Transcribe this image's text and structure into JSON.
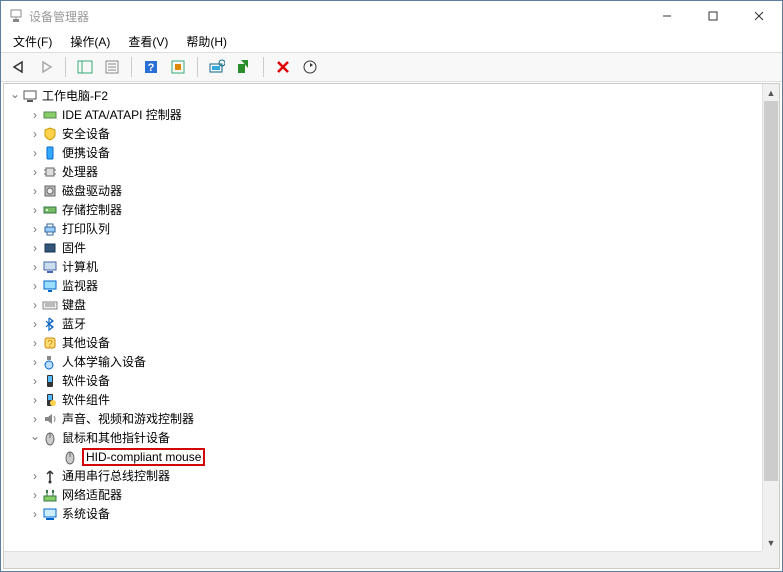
{
  "window": {
    "title": "设备管理器",
    "controls": {
      "min": "—",
      "max": "▢",
      "close": "✕"
    }
  },
  "menu": {
    "file": "文件(F)",
    "action": "操作(A)",
    "view": "查看(V)",
    "help": "帮助(H)"
  },
  "toolbar": {
    "back": "←",
    "forward": "→",
    "refresh": "⟳",
    "delete": "✕",
    "help_glyph": "?"
  },
  "tree": {
    "root": "工作电脑-F2",
    "expanded_root": true,
    "categories": [
      {
        "icon": "ide-icon",
        "label": "IDE ATA/ATAPI 控制器"
      },
      {
        "icon": "security-icon",
        "label": "安全设备"
      },
      {
        "icon": "portable-icon",
        "label": "便携设备"
      },
      {
        "icon": "cpu-icon",
        "label": "处理器"
      },
      {
        "icon": "disk-icon",
        "label": "磁盘驱动器"
      },
      {
        "icon": "storage-icon",
        "label": "存储控制器"
      },
      {
        "icon": "print-icon",
        "label": "打印队列"
      },
      {
        "icon": "firmware-icon",
        "label": "固件"
      },
      {
        "icon": "computer-icon",
        "label": "计算机"
      },
      {
        "icon": "monitor-icon",
        "label": "监视器"
      },
      {
        "icon": "keyboard-icon",
        "label": "键盘"
      },
      {
        "icon": "bt-icon",
        "label": "蓝牙"
      },
      {
        "icon": "other-icon",
        "label": "其他设备"
      },
      {
        "icon": "hid-icon",
        "label": "人体学输入设备"
      },
      {
        "icon": "soft-icon",
        "label": "软件设备"
      },
      {
        "icon": "comp-icon",
        "label": "软件组件"
      },
      {
        "icon": "audio-icon",
        "label": "声音、视频和游戏控制器"
      },
      {
        "icon": "mouse-cat-icon",
        "label": "鼠标和其他指针设备",
        "expanded": true,
        "children": [
          {
            "icon": "mouse-icon",
            "label": "HID-compliant mouse",
            "highlight": true
          }
        ]
      },
      {
        "icon": "usb-icon",
        "label": "通用串行总线控制器"
      },
      {
        "icon": "net-icon",
        "label": "网络适配器"
      },
      {
        "icon": "sys-icon",
        "label": "系统设备"
      }
    ]
  }
}
